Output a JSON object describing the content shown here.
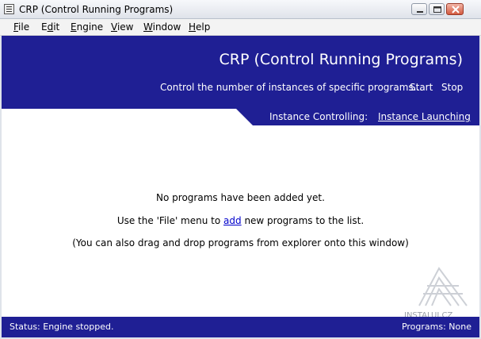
{
  "window": {
    "title": "CRP (Control Running Programs)",
    "icon": "app-icon",
    "buttons": [
      "minimize-icon",
      "maximize-icon",
      "close-icon"
    ]
  },
  "menu": {
    "items": [
      {
        "pre": "",
        "u": "F",
        "post": "ile"
      },
      {
        "pre": "E",
        "u": "d",
        "post": "it"
      },
      {
        "pre": "",
        "u": "E",
        "post": "ngine"
      },
      {
        "pre": "",
        "u": "V",
        "post": "iew"
      },
      {
        "pre": "",
        "u": "W",
        "post": "indow"
      },
      {
        "pre": "",
        "u": "H",
        "post": "elp"
      }
    ]
  },
  "header": {
    "title": "CRP (Control Running Programs)",
    "tagline": "Control the number of instances of specific programs...",
    "start_label": "Start",
    "stop_label": "Stop",
    "instance_label": "Instance Controlling:",
    "instance_link": "Instance Launching",
    "bg_color": "#1f1f94"
  },
  "main": {
    "line1": "No programs have been added yet.",
    "line2_pre": "Use the 'File' menu to ",
    "line2_link": "add",
    "line2_post": " new programs to the list.",
    "line3": "(You can also drag and drop programs from explorer onto this window)"
  },
  "watermark": {
    "text": "INSTALUJ.CZ"
  },
  "status": {
    "left": "Status:  Engine stopped.",
    "right": "Programs:  None"
  }
}
